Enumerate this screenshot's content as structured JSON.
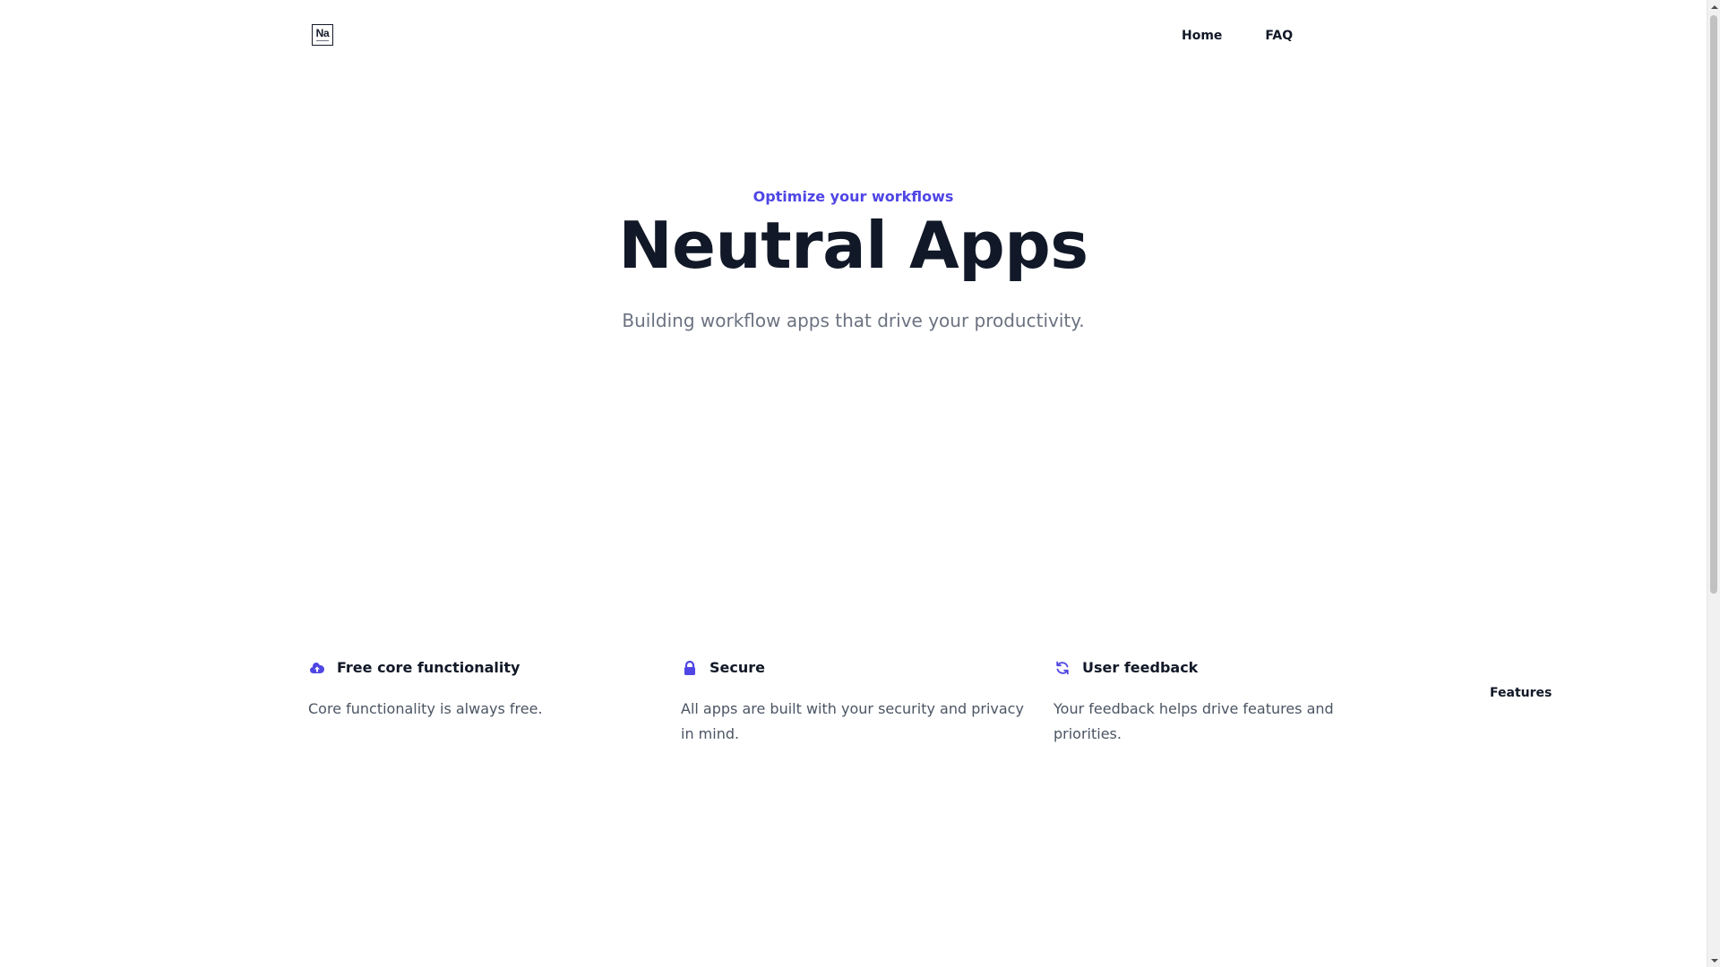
{
  "brand": {
    "logo_text": "Na",
    "accent_color": "#4f46e5"
  },
  "nav": {
    "items": [
      {
        "label": "Home"
      },
      {
        "label": "Features"
      },
      {
        "label": "FAQ"
      }
    ]
  },
  "hero": {
    "eyebrow": "Optimize your workflows",
    "title": "Neutral Apps",
    "subtitle": "Building workflow apps that drive your productivity."
  },
  "features": [
    {
      "icon": "cloud-upload-icon",
      "title": "Free core functionality",
      "description": "Core functionality is always free."
    },
    {
      "icon": "lock-icon",
      "title": "Secure",
      "description": "All apps are built with your security and privacy in mind."
    },
    {
      "icon": "refresh-icon",
      "title": "User feedback",
      "description": "Your feedback helps drive features and priorities."
    }
  ]
}
